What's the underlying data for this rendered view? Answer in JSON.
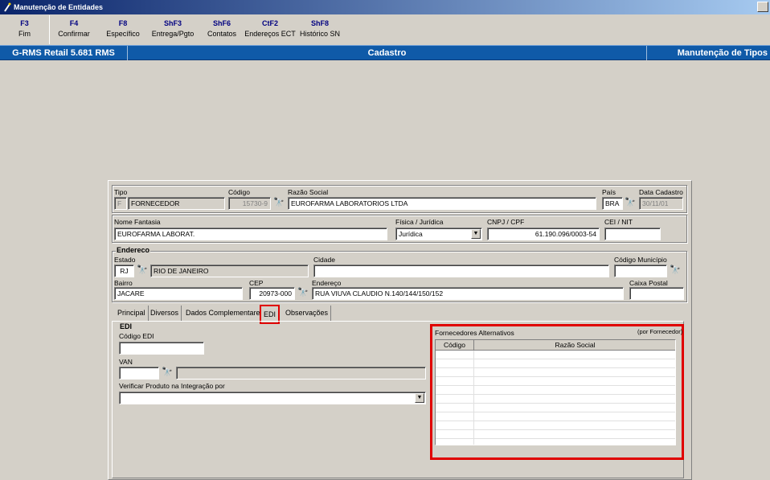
{
  "window": {
    "title": "Manutenção de Entidades"
  },
  "toolbar": [
    {
      "key": "F3",
      "label": "Fim"
    },
    {
      "key": "F4",
      "label": "Confirmar"
    },
    {
      "key": "F8",
      "label": "Específico"
    },
    {
      "key": "ShF3",
      "label": "Entrega/Pgto"
    },
    {
      "key": "ShF6",
      "label": "Contatos"
    },
    {
      "key": "CtF2",
      "label": "Endereços ECT"
    },
    {
      "key": "ShF8",
      "label": "Histórico SN"
    }
  ],
  "statusbar": {
    "left": "G-RMS Retail 5.681 RMS",
    "center": "Cadastro",
    "right": "Manutenção de Tipos"
  },
  "form": {
    "tipo_label": "Tipo",
    "tipo_code": "F",
    "tipo_value": "FORNECEDOR",
    "codigo_label": "Código",
    "codigo_value": "15730-9",
    "razao_label": "Razão Social",
    "razao_value": "EUROFARMA LABORATORIOS LTDA",
    "pais_label": "País",
    "pais_value": "BRA",
    "data_label": "Data Cadastro",
    "data_value": "30/11/01",
    "fantasia_label": "Nome Fantasia",
    "fantasia_value": "EUROFARMA LABORAT.",
    "fisica_label": "Física / Jurídica",
    "fisica_value": "Jurídica",
    "cnpj_label": "CNPJ / CPF",
    "cnpj_value": "61.190.096/0003-54",
    "cei_label": "CEI / NIT",
    "cei_value": "",
    "endereco_group": "Endereco",
    "estado_label": "Estado",
    "estado_code": "RJ",
    "estado_value": "RIO DE JANEIRO",
    "cidade_label": "Cidade",
    "cidade_value": "",
    "municipio_label": "Código Município",
    "municipio_value": "",
    "bairro_label": "Bairro",
    "bairro_value": "JACARE",
    "cep_label": "CEP",
    "cep_value": "20973-000",
    "endereco_label": "Endereço",
    "endereco_value": "RUA VIUVA CLAUDIO N.140/144/150/152",
    "caixa_label": "Caixa Postal",
    "caixa_value": ""
  },
  "tabs": [
    "Principal",
    "Diversos",
    "Dados Complementares",
    "EDI",
    "Observações"
  ],
  "edi": {
    "group": "EDI",
    "codigo_label": "Código EDI",
    "codigo_value": "",
    "van_label": "VAN",
    "van_value": "",
    "van_desc": "",
    "verificar_label": "Verificar Produto na Integração por",
    "verificar_value": ""
  },
  "alternativos": {
    "title": "Fornecedores Alternativos",
    "note": "(por Fornecedor)",
    "columns": [
      "Código",
      "Razão Social"
    ]
  }
}
